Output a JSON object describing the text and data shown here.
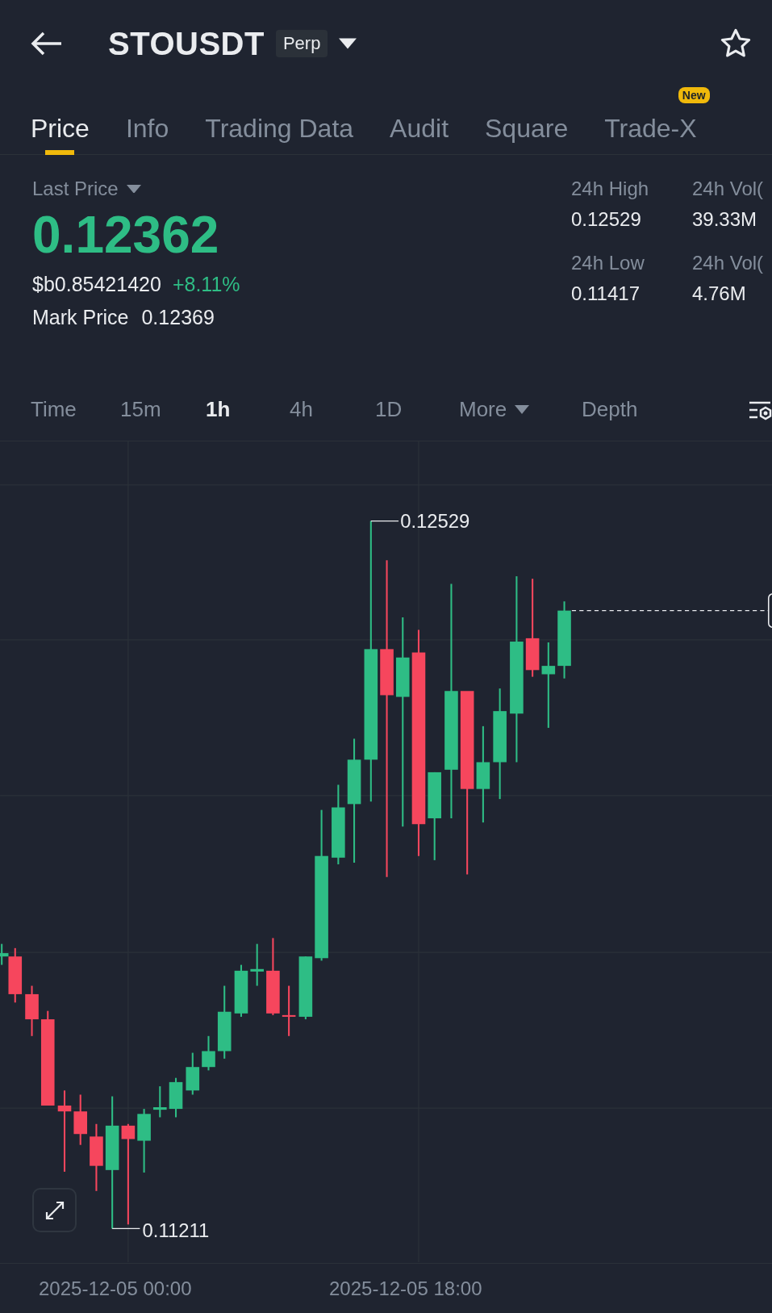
{
  "header": {
    "symbol": "STOUSDT",
    "contract_badge": "Perp"
  },
  "tabs": [
    {
      "label": "Price",
      "selected": true
    },
    {
      "label": "Info",
      "selected": false
    },
    {
      "label": "Trading Data",
      "selected": false
    },
    {
      "label": "Audit",
      "selected": false
    },
    {
      "label": "Square",
      "selected": false
    },
    {
      "label": "Trade-X",
      "selected": false,
      "badge": "New"
    }
  ],
  "price": {
    "label": "Last Price",
    "value": "0.12362",
    "fiat_value": "$b0.85421420",
    "change": "+8.11%",
    "mark_label": "Mark Price",
    "mark_value": "0.12369"
  },
  "stats": [
    {
      "label": "24h High",
      "value": "0.12529"
    },
    {
      "label": "24h Vol(",
      "value": "39.33M"
    },
    {
      "label": "24h Low",
      "value": "0.11417"
    },
    {
      "label": "24h Vol(",
      "value": "4.76M"
    }
  ],
  "intervals": [
    {
      "label": "Time",
      "selected": false,
      "kind": "plain"
    },
    {
      "label": "15m",
      "selected": false,
      "kind": "plain"
    },
    {
      "label": "1h",
      "selected": true,
      "kind": "plain"
    },
    {
      "label": "4h",
      "selected": false,
      "kind": "plain"
    },
    {
      "label": "1D",
      "selected": false,
      "kind": "plain"
    },
    {
      "label": "More",
      "selected": false,
      "kind": "menu"
    },
    {
      "label": "Depth",
      "selected": false,
      "kind": "plain"
    }
  ],
  "chart": {
    "high_label": "0.12529",
    "low_label": "0.11211",
    "x_labels": [
      "2025-12-05 00:00",
      "2025-12-05 18:00"
    ]
  }
}
